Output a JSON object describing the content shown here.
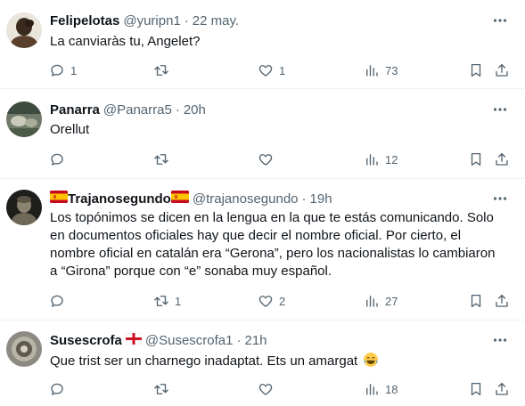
{
  "tweets": [
    {
      "name": "Felipelotas",
      "handle": "@yuripn1",
      "time": "22 may.",
      "text": "La canviaràs tu, Angelet?",
      "reply_count": "1",
      "retweet_count": "",
      "like_count": "1",
      "view_count": "73"
    },
    {
      "name": "Panarra",
      "handle": "@Panarra5",
      "time": "20h",
      "text": "Orellut",
      "reply_count": "",
      "retweet_count": "",
      "like_count": "",
      "view_count": "12"
    },
    {
      "name": "Trajanosegundo",
      "handle": "@trajanosegundo",
      "time": "19h",
      "text_lines": [
        "Los topónimos se dicen en la lengua en la que te estás comunicando. Solo",
        "en documentos oficiales hay que decir el nombre oficial. Por cierto, el",
        "nombre oficial en catalán era “Gerona”, pero los nacionalistas lo cambiaron",
        "a “Girona” porque con “e” sonaba muy español."
      ],
      "reply_count": "",
      "retweet_count": "1",
      "like_count": "2",
      "view_count": "27"
    },
    {
      "name": "Susescrofa",
      "handle": "@Susescrofa1",
      "time": "21h",
      "text": "Que trist ser un charnego inadaptat. Ets un amargat",
      "reply_count": "",
      "retweet_count": "",
      "like_count": "",
      "view_count": "18"
    }
  ],
  "separator": "·",
  "more_glyph": "···",
  "colors": {
    "text": "#0f1419",
    "secondary": "#536471",
    "divider": "#eff3f4",
    "flag_es_red": "#c60b1e",
    "flag_es_yellow": "#ffc400",
    "flag_en_red": "#ce1124"
  },
  "icons": [
    "reply-icon",
    "retweet-icon",
    "like-icon",
    "views-icon",
    "bookmark-icon",
    "share-icon",
    "more-icon",
    "flag-es-icon",
    "flag-england-icon",
    "laughing-emoji-icon"
  ]
}
